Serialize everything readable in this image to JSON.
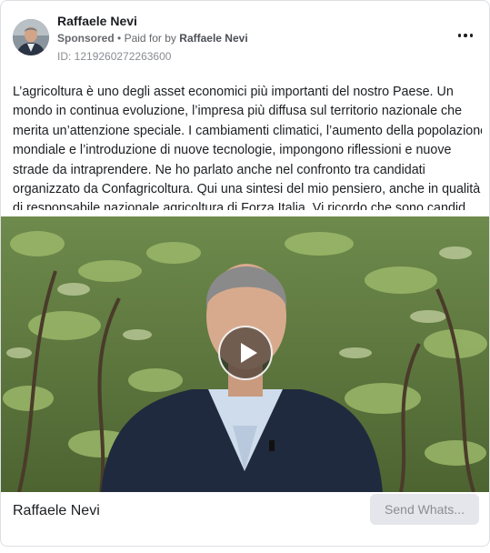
{
  "ad": {
    "page_name": "Raffaele Nevi",
    "sponsored_label": "Sponsored",
    "paid_for_prefix": "Paid for by",
    "paid_for_by": "Raffaele Nevi",
    "id_text": "ID: 1219260272263600",
    "more_icon": "more-horizontal-icon",
    "body_lines": [
      "L’agricoltura è uno degli asset economici più importanti del nostro Paese. Un",
      "mondo in continua evoluzione, l’impresa più diffusa sul territorio nazionale che",
      "merita un’attenzione speciale. I cambiamenti climatici, l’aumento della popolazione",
      "mondiale e l’introduzione di nuove tecnologie, impongono riflessioni e nuove",
      "strade da intraprendere. Ne ho parlato anche nel confronto tra candidati",
      "organizzato da Confagricoltura. Qui una sintesi del mio pensiero, anche in qualità",
      "di responsabile nazionale agricoltura di Forza Italia. Vi ricordo che sono candidat…"
    ],
    "play_icon": "play-icon"
  },
  "footer": {
    "name": "Raffaele Nevi",
    "cta_label": "Send Whats..."
  }
}
